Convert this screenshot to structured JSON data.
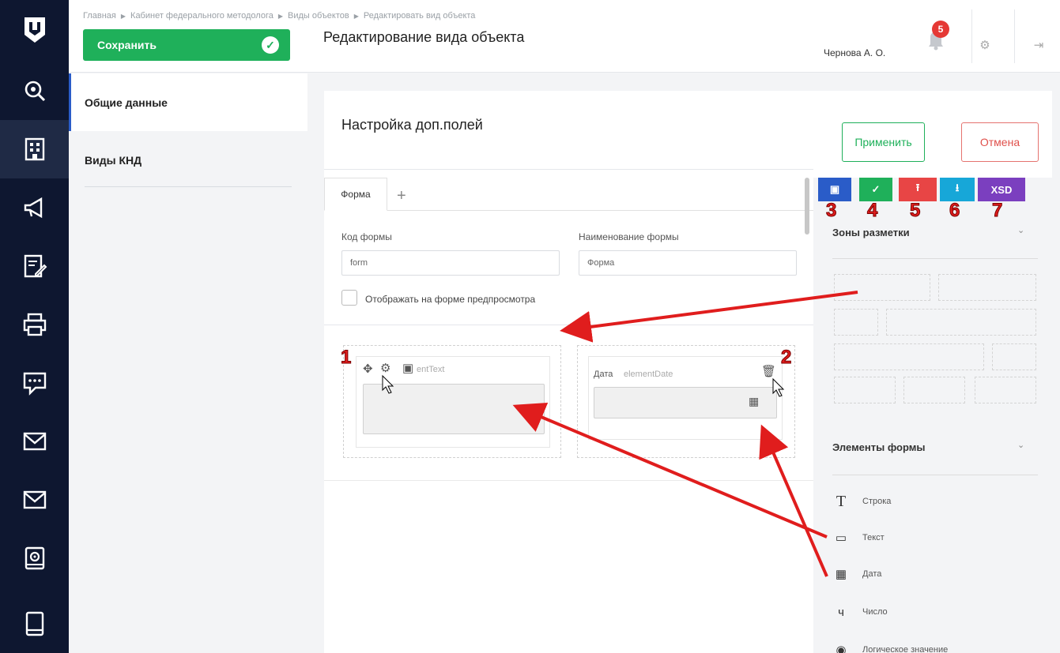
{
  "breadcrumb": [
    "Главная",
    "Кабинет федерального методолога",
    "Виды объектов",
    "Редактировать вид объекта"
  ],
  "header": {
    "save_label": "Сохранить",
    "title": "Редактирование вида объекта",
    "user": "Чернова А. О.",
    "notifications": "5"
  },
  "subnav": {
    "items": [
      {
        "label": "Общие данные"
      },
      {
        "label": "Виды КНД"
      }
    ]
  },
  "panel": {
    "title": "Настройка доп.полей",
    "apply": "Применить",
    "cancel": "Отмена"
  },
  "editor": {
    "tab": "Форма",
    "code_label": "Код формы",
    "code_value": "form",
    "name_label": "Наименование формы",
    "name_value": "Форма",
    "preview_label": "Отображать на форме предпросмотра",
    "element1_label": "entText",
    "element2_label": "Дата",
    "element2_name": "elementDate"
  },
  "palette": {
    "toolbar": {
      "xsd": "XSD"
    },
    "zones_title": "Зоны разметки",
    "elements_title": "Элементы формы",
    "items": [
      {
        "label": "Строка",
        "icon": "T"
      },
      {
        "label": "Текст",
        "icon": "comment"
      },
      {
        "label": "Дата",
        "icon": "calendar"
      },
      {
        "label": "Число",
        "icon": "number"
      },
      {
        "label": "Логическое значение",
        "icon": "radio"
      }
    ]
  },
  "annotations": [
    "1",
    "2",
    "3",
    "4",
    "5",
    "6",
    "7"
  ],
  "colors": {
    "accent_green": "#1fb05a",
    "nav_dark": "#0e1730",
    "annotation_red": "#e01d1d",
    "toolbar_blue": "#2a5cc8",
    "toolbar_red": "#e84545",
    "toolbar_cyan": "#17a7d8",
    "toolbar_purple": "#7b3fbf"
  }
}
